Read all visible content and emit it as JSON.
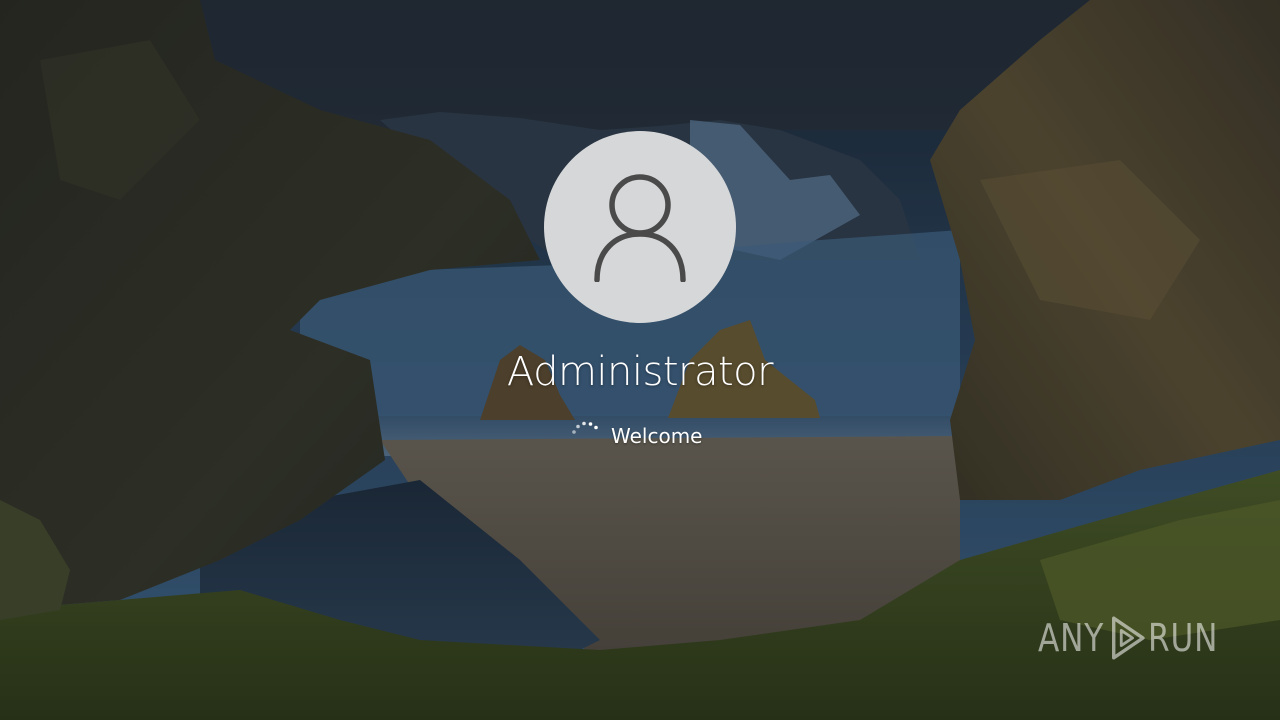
{
  "lock_screen": {
    "user_name": "Administrator",
    "status_text": "Welcome",
    "avatar_icon": "user-silhouette-icon",
    "spinner_icon": "loading-spinner-icon"
  },
  "watermark": {
    "left_text": "ANY",
    "icon": "play-triangle-icon",
    "right_text": "RUN"
  },
  "colors": {
    "text": "#ffffff",
    "avatar_background": "#d6d7d9",
    "avatar_glyph": "#4a4a4a"
  }
}
